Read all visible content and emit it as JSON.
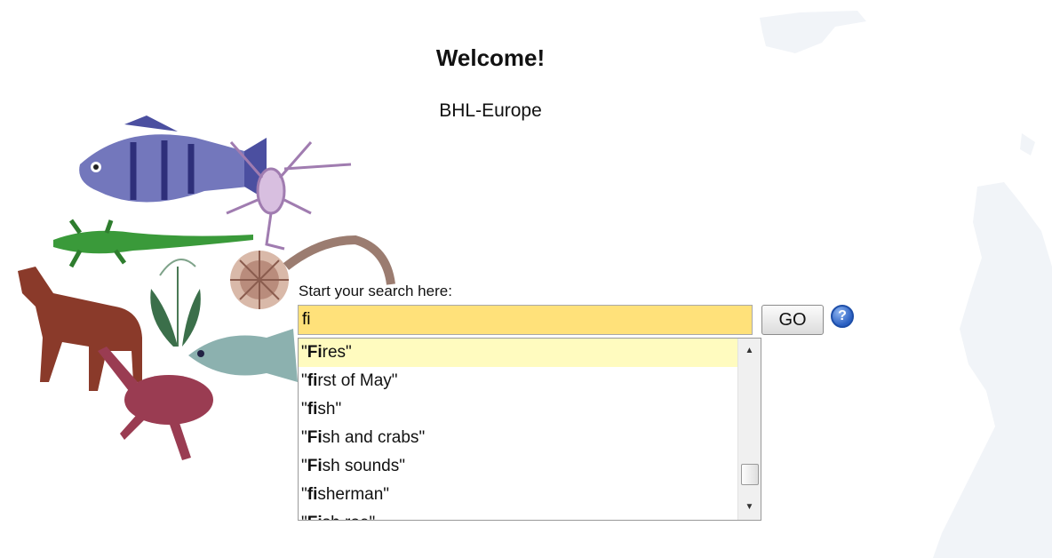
{
  "header": {
    "title": "Welcome!",
    "subtitle": "BHL-Europe"
  },
  "search": {
    "label": "Start your search here:",
    "value": "fi",
    "go_label": "GO",
    "help_icon": "?",
    "suggestions": [
      {
        "open": "\"",
        "match": "Fi",
        "rest": "res",
        "close": "\""
      },
      {
        "open": "\"",
        "match": "fi",
        "rest": "rst of May",
        "close": "\""
      },
      {
        "open": "\"",
        "match": "fi",
        "rest": "sh",
        "close": "\""
      },
      {
        "open": "\"",
        "match": "Fi",
        "rest": "sh and crabs",
        "close": "\""
      },
      {
        "open": "\"",
        "match": "Fi",
        "rest": "sh sounds",
        "close": "\""
      },
      {
        "open": "\"",
        "match": "fi",
        "rest": "sherman",
        "close": "\""
      },
      {
        "open": "\"",
        "match": "Fi",
        "rest": "sh roe",
        "close": "\""
      }
    ]
  },
  "colors": {
    "input_bg": "#ffe17a",
    "selected_row": "#fffbbf",
    "help_blue": "#2a5fc2"
  },
  "icons": {
    "help": "help-icon",
    "scroll_up": "scroll-up-arrow-icon",
    "scroll_down": "scroll-down-arrow-icon"
  }
}
